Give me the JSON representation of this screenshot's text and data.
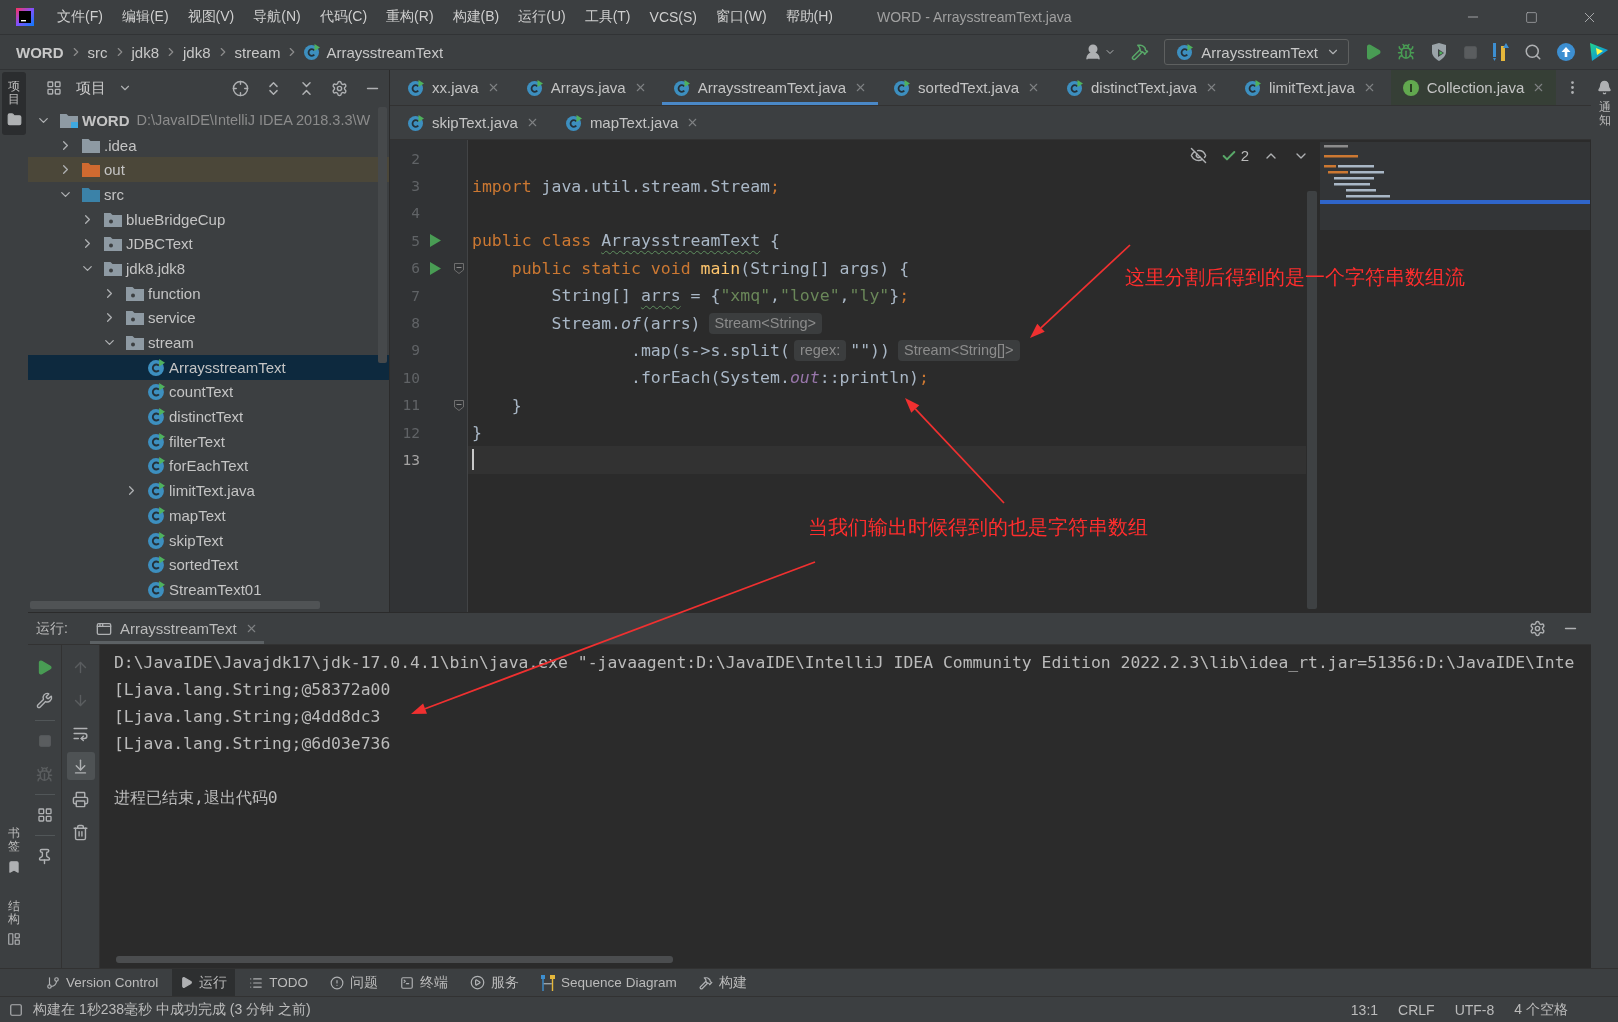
{
  "title_bar": {
    "menu": [
      "文件(F)",
      "编辑(E)",
      "视图(V)",
      "导航(N)",
      "代码(C)",
      "重构(R)",
      "构建(B)",
      "运行(U)",
      "工具(T)",
      "VCS(S)",
      "窗口(W)",
      "帮助(H)"
    ],
    "title": "WORD - ArraysstreamText.java"
  },
  "nav_bar": {
    "breadcrumbs": [
      {
        "label": "WORD",
        "kind": "project"
      },
      {
        "label": "src",
        "kind": "folder"
      },
      {
        "label": "jdk8",
        "kind": "folder"
      },
      {
        "label": "jdk8",
        "kind": "folder"
      },
      {
        "label": "stream",
        "kind": "folder"
      },
      {
        "label": "ArraysstreamText",
        "kind": "class"
      }
    ],
    "run_config": "ArraysstreamText",
    "stop_disabled": true
  },
  "tool_strips": {
    "left_top": [
      {
        "label": "项目",
        "kind": "project",
        "selected": true
      }
    ],
    "left_bottom": [
      {
        "label": "书签",
        "kind": "bookmarks",
        "selected": false
      },
      {
        "label": "结构",
        "kind": "structure",
        "selected": false
      }
    ],
    "right": [
      {
        "label": "通知",
        "kind": "notifications",
        "selected": false
      }
    ]
  },
  "project_panel": {
    "title": "项目",
    "tree": [
      {
        "label": "WORD",
        "kind": "project",
        "path": "D:\\JavaIDE\\IntelliJ IDEA 2018.3.3\\W",
        "expanded": true,
        "selected": false,
        "children": [
          {
            "label": ".idea",
            "kind": "folder",
            "expanded": false,
            "selected": false
          },
          {
            "label": "out",
            "kind": "excluded_folder",
            "expanded": false,
            "selected": false
          },
          {
            "label": "src",
            "kind": "source_folder",
            "expanded": true,
            "selected": false,
            "children": [
              {
                "label": "blueBridgeCup",
                "kind": "package",
                "expanded": false,
                "selected": false
              },
              {
                "label": "JDBCText",
                "kind": "package",
                "expanded": false,
                "selected": false
              },
              {
                "label": "jdk8.jdk8",
                "kind": "package",
                "expanded": true,
                "selected": false,
                "children": [
                  {
                    "label": "function",
                    "kind": "package",
                    "expanded": false,
                    "selected": false
                  },
                  {
                    "label": "service",
                    "kind": "package",
                    "expanded": false,
                    "selected": false
                  },
                  {
                    "label": "stream",
                    "kind": "package",
                    "expanded": true,
                    "selected": false,
                    "children": [
                      {
                        "label": "ArraysstreamText",
                        "kind": "class",
                        "selected": true
                      },
                      {
                        "label": "countText",
                        "kind": "class",
                        "selected": false
                      },
                      {
                        "label": "distinctText",
                        "kind": "class",
                        "selected": false
                      },
                      {
                        "label": "filterText",
                        "kind": "class",
                        "selected": false
                      },
                      {
                        "label": "forEachText",
                        "kind": "class",
                        "selected": false
                      },
                      {
                        "label": "limitText.java",
                        "kind": "class",
                        "expanded": false,
                        "selected": false
                      },
                      {
                        "label": "mapText",
                        "kind": "class",
                        "selected": false
                      },
                      {
                        "label": "skipText",
                        "kind": "class",
                        "selected": false
                      },
                      {
                        "label": "sortedText",
                        "kind": "class",
                        "selected": false
                      },
                      {
                        "label": "StreamText01",
                        "kind": "class",
                        "selected": false
                      }
                    ]
                  }
                ]
              }
            ]
          }
        ]
      }
    ]
  },
  "editor": {
    "tab_rows": [
      {
        "tabs": [
          {
            "label": "xx.java",
            "kind": "class",
            "selected": false
          },
          {
            "label": "Arrays.java",
            "kind": "class",
            "selected": false
          },
          {
            "label": "ArraysstreamText.java",
            "kind": "class",
            "selected": true
          },
          {
            "label": "sortedText.java",
            "kind": "class",
            "selected": false
          },
          {
            "label": "distinctText.java",
            "kind": "class",
            "selected": false
          },
          {
            "label": "limitText.java",
            "kind": "class",
            "selected": false
          },
          {
            "label": "Collection.java",
            "kind": "interface",
            "selected": false
          }
        ]
      },
      {
        "tabs": [
          {
            "label": "skipText.java",
            "kind": "class",
            "selected": false
          },
          {
            "label": "mapText.java",
            "kind": "class",
            "selected": false
          }
        ]
      }
    ],
    "inspection_count": "2",
    "lines": [
      {
        "number": "2",
        "run_marker": false,
        "fold_marker": false,
        "current": false
      },
      {
        "number": "3",
        "tokens": [
          {
            "kind": "keyword",
            "text": "import"
          },
          {
            "kind": "plain",
            "text": " java.util.stream.Stream"
          },
          {
            "kind": "keyword",
            "text": ";"
          }
        ],
        "run_marker": false,
        "fold_marker": false,
        "current": false
      },
      {
        "number": "4",
        "run_marker": false,
        "fold_marker": false,
        "current": false
      },
      {
        "number": "5",
        "tokens": [
          {
            "kind": "keyword",
            "text": "public class "
          },
          {
            "kind": "typo",
            "text": "ArraysstreamText"
          },
          {
            "kind": "plain",
            "text": " {"
          }
        ],
        "run_marker": true,
        "fold_marker": false,
        "current": false
      },
      {
        "number": "6",
        "tokens": [
          {
            "kind": "keyword",
            "text": "    public static void "
          },
          {
            "kind": "method",
            "text": "main"
          },
          {
            "kind": "plain",
            "text": "(String[] args) {"
          }
        ],
        "run_marker": true,
        "fold_marker": true,
        "current": false
      },
      {
        "number": "7",
        "tokens": [
          {
            "kind": "plain",
            "text": "        String[] "
          },
          {
            "kind": "typo",
            "text": "arrs"
          },
          {
            "kind": "plain",
            "text": " = {"
          },
          {
            "kind": "string",
            "text": "\"xmq\""
          },
          {
            "kind": "plain",
            "text": ","
          },
          {
            "kind": "string",
            "text": "\"love\""
          },
          {
            "kind": "plain",
            "text": ","
          },
          {
            "kind": "string",
            "text": "\"ly\""
          },
          {
            "kind": "plain",
            "text": "}"
          },
          {
            "kind": "keyword",
            "text": ";"
          }
        ],
        "run_marker": false,
        "fold_marker": false,
        "current": false
      },
      {
        "number": "8",
        "tokens": [
          {
            "kind": "plain",
            "text": "        Stream."
          },
          {
            "kind": "static_method",
            "text": "of"
          },
          {
            "kind": "plain",
            "text": "(arrs)"
          },
          {
            "kind": "hint",
            "text": "Stream<String>"
          }
        ],
        "run_marker": false,
        "fold_marker": false,
        "current": false
      },
      {
        "number": "9",
        "tokens": [
          {
            "kind": "plain",
            "text": "                .map(s->s.split("
          },
          {
            "kind": "hint",
            "text": "regex:"
          },
          {
            "kind": "plain",
            "text": "\"\"))"
          },
          {
            "kind": "hint",
            "text": "Stream<String[]>"
          }
        ],
        "run_marker": false,
        "fold_marker": false,
        "current": false
      },
      {
        "number": "10",
        "tokens": [
          {
            "kind": "plain",
            "text": "                .forEach(System."
          },
          {
            "kind": "static_field",
            "text": "out"
          },
          {
            "kind": "plain",
            "text": "::println)"
          },
          {
            "kind": "keyword",
            "text": ";"
          }
        ],
        "run_marker": false,
        "fold_marker": false,
        "current": false
      },
      {
        "number": "11",
        "tokens": [
          {
            "kind": "plain",
            "text": "    }"
          }
        ],
        "run_marker": false,
        "fold_marker": true,
        "current": false
      },
      {
        "number": "12",
        "tokens": [
          {
            "kind": "plain",
            "text": "}"
          }
        ],
        "run_marker": false,
        "fold_marker": false,
        "current": false
      },
      {
        "number": "13",
        "run_marker": false,
        "fold_marker": false,
        "current": true
      }
    ],
    "annotations": [
      {
        "text": "这里分割后得到的是一个字符串数组流"
      },
      {
        "text": "当我们输出时候得到的也是字符串数组"
      }
    ]
  },
  "run_panel": {
    "label": "运行:",
    "tab": "ArraysstreamText",
    "stop_disabled": true,
    "scroll_to_end": true,
    "console": [
      {
        "kind": "command",
        "text": "D:\\JavaIDE\\Javajdk17\\jdk-17.0.4.1\\bin\\java.exe \"-javaagent:D:\\JavaIDE\\IntelliJ IDEA Community Edition 2022.2.3\\lib\\idea_rt.jar=51356:D:\\JavaIDE\\Inte"
      },
      {
        "kind": "output",
        "text": "[Ljava.lang.String;@58372a00"
      },
      {
        "kind": "output",
        "text": "[Ljava.lang.String;@4dd8dc3"
      },
      {
        "kind": "output",
        "text": "[Ljava.lang.String;@6d03e736"
      },
      {
        "kind": "exit",
        "text": "进程已结束,退出代码0"
      }
    ]
  },
  "tool_tabs": [
    {
      "label": "Version Control",
      "kind": "vcs",
      "selected": false
    },
    {
      "label": "运行",
      "kind": "run",
      "selected": true
    },
    {
      "label": "TODO",
      "kind": "todo",
      "selected": false
    },
    {
      "label": "问题",
      "kind": "problems",
      "selected": false
    },
    {
      "label": "终端",
      "kind": "terminal",
      "selected": false
    },
    {
      "label": "服务",
      "kind": "services",
      "selected": false
    },
    {
      "label": "Sequence Diagram",
      "kind": "diagram",
      "selected": false
    },
    {
      "label": "构建",
      "kind": "build",
      "selected": false
    }
  ],
  "status_bar": {
    "message": "构建在 1秒238毫秒 中成功完成 (3 分钟 之前)",
    "items": [
      "13:1",
      "CRLF",
      "UTF-8",
      "4 个空格"
    ]
  }
}
